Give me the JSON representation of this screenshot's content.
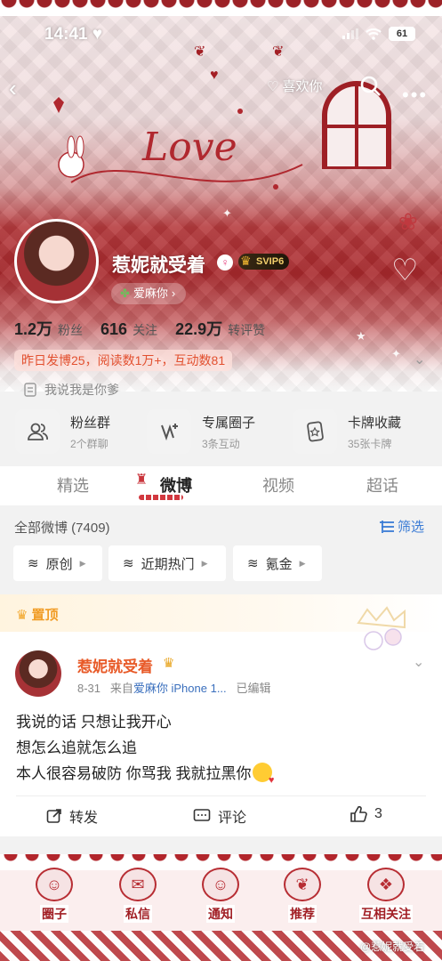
{
  "status_bar": {
    "time": "14:41",
    "battery": "61"
  },
  "header": {
    "like_label": "喜欢你"
  },
  "banner": {
    "art_text": "Love"
  },
  "profile": {
    "name": "惹妮就受着",
    "vip_badge": "SVIP6",
    "fan_tag": "爱麻你",
    "stats": [
      {
        "value": "1.2万",
        "label": "粉丝"
      },
      {
        "value": "616",
        "label": "关注"
      },
      {
        "value": "22.9万",
        "label": "转评赞"
      }
    ],
    "summary": "昨日发博25，阅读数1万+，互动数81",
    "bio": "我说我是你爹"
  },
  "features": [
    {
      "title": "粉丝群",
      "sub": "2个群聊",
      "icon": "group-icon"
    },
    {
      "title": "专属圈子",
      "sub": "3条互动",
      "icon": "circle-icon"
    },
    {
      "title": "卡牌收藏",
      "sub": "35张卡牌",
      "icon": "card-icon"
    }
  ],
  "tabs": [
    {
      "label": "精选",
      "active": false
    },
    {
      "label": "微博",
      "active": true
    },
    {
      "label": "视频",
      "active": false
    },
    {
      "label": "超话",
      "active": false
    }
  ],
  "feed": {
    "all_label": "全部微博 (7409)",
    "filter_label": "筛选",
    "chips": [
      "原创",
      "近期热门",
      "氪金"
    ]
  },
  "post": {
    "pinned_label": "置顶",
    "author": "惹妮就受着",
    "date": "8-31",
    "source_prefix": "来自",
    "source": "爱麻你 iPhone 1...",
    "edited": "已编辑",
    "lines": [
      "我说的话 只想让我开心",
      "想怎么追就怎么追",
      "本人很容易破防 你骂我 我就拉黑你"
    ],
    "actions": [
      {
        "label": "转发",
        "icon": "repost-icon"
      },
      {
        "label": "评论",
        "icon": "comment-icon"
      },
      {
        "label": "3",
        "icon": "like-icon"
      }
    ]
  },
  "bottom_nav": [
    {
      "label": "圈子",
      "icon": "circle-icon"
    },
    {
      "label": "私信",
      "icon": "message-icon"
    },
    {
      "label": "通知",
      "icon": "notification-icon"
    },
    {
      "label": "推荐",
      "icon": "recommend-icon"
    },
    {
      "label": "互相关注",
      "icon": "mutual-follow-icon"
    }
  ],
  "watermark": "@惹妮就受着",
  "colors": {
    "accent_red": "#a8282c",
    "author_orange": "#e85a28",
    "link_blue": "#3a6fbd",
    "pinned_orange": "#f19c25"
  }
}
